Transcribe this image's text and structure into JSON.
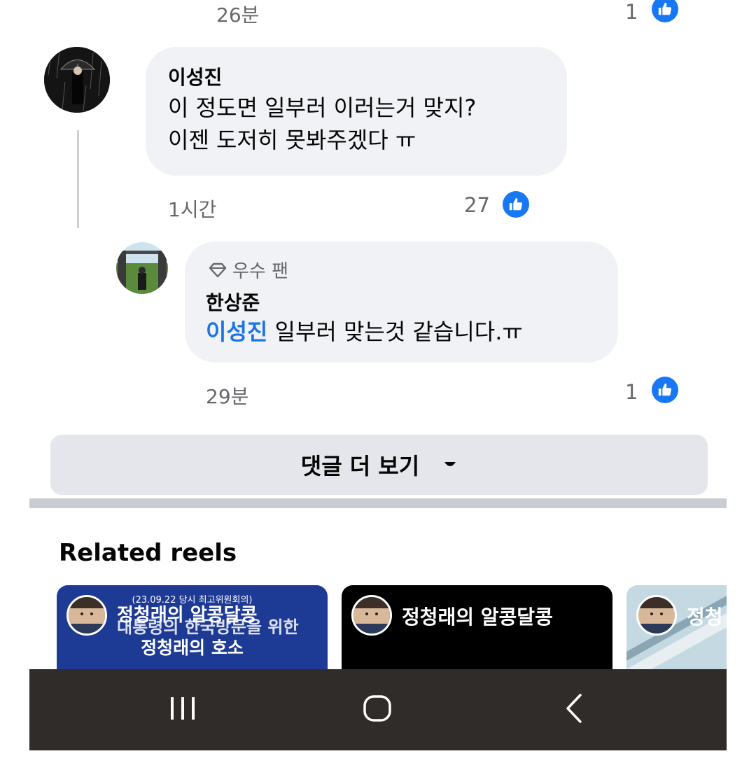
{
  "top_comment": {
    "time": "26분",
    "likes": "1"
  },
  "comment1": {
    "author": "이성진",
    "lines": [
      "이 정도면 일부러 이러는거 맞지?",
      "이젠 도저히 못봐주겠다 ㅠ"
    ],
    "time": "1시간",
    "likes": "27"
  },
  "reply1": {
    "badge_icon": "diamond-icon",
    "badge": "우수 팬",
    "author": "한상준",
    "mention": "이성진",
    "text": " 일부러 맞는것 같습니다.ㅠ",
    "time": "29분",
    "likes": "1"
  },
  "more_comments_label": "댓글 더 보기",
  "related": {
    "title": "Related reels",
    "reels": [
      {
        "small_caption": "(23.09.22 당시 최고위원회의)",
        "title_line1": "정청래의 알콩달콩",
        "overlap_line": "대통령의 한국방문을 위한",
        "title_line2": "정청래의 호소",
        "bg": "#1d3a94"
      },
      {
        "title": "정청래의 알콩달콩",
        "bg": "#000000"
      },
      {
        "title": "정청",
        "bg": "#a9c8d8"
      }
    ]
  },
  "navbar": {
    "recent_icon": "recent-apps-icon",
    "home_icon": "home-icon",
    "back_icon": "back-icon"
  },
  "colors": {
    "accent": "#1877f2",
    "bubble": "#f0f2f5",
    "meta": "#65676b",
    "navbar": "#2f2c2a"
  }
}
